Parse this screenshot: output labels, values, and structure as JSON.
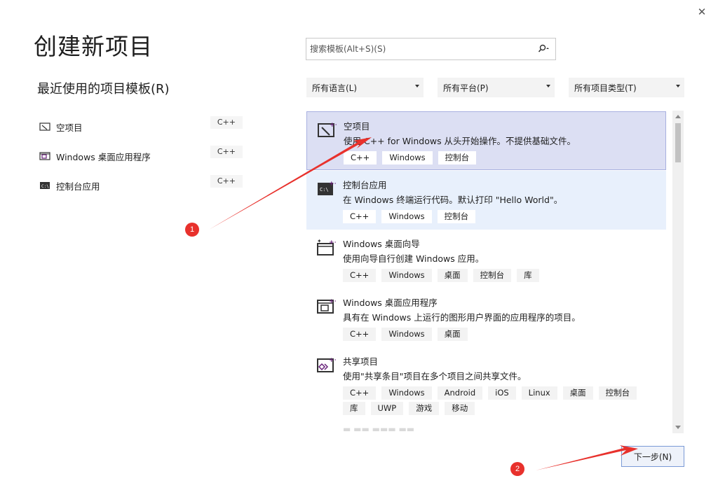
{
  "window": {
    "close_glyph": "✕"
  },
  "page": {
    "title": "创建新项目",
    "recent_title": "最近使用的项目模板(R)"
  },
  "recent": [
    {
      "label": "空项目",
      "tag": "C++",
      "icon": "empty-project-icon"
    },
    {
      "label": "Windows 桌面应用程序",
      "tag": "C++",
      "icon": "desktop-app-icon"
    },
    {
      "label": "控制台应用",
      "tag": "C++",
      "icon": "console-app-icon"
    }
  ],
  "search": {
    "placeholder": "搜索模板(Alt+S)(S)",
    "value": ""
  },
  "filters": {
    "language": "所有语言(L)",
    "platform": "所有平台(P)",
    "type": "所有项目类型(T)"
  },
  "templates": [
    {
      "title": "空项目",
      "desc": "使用 C++ for Windows 从头开始操作。不提供基础文件。",
      "tags": [
        "C++",
        "Windows",
        "控制台"
      ],
      "state": "selected",
      "icon": "empty-project-icon"
    },
    {
      "title": "控制台应用",
      "desc": "在 Windows 终端运行代码。默认打印 \"Hello World\"。",
      "tags": [
        "C++",
        "Windows",
        "控制台"
      ],
      "state": "hover",
      "icon": "console-app-icon"
    },
    {
      "title": "Windows 桌面向导",
      "desc": "使用向导自行创建 Windows 应用。",
      "tags": [
        "C++",
        "Windows",
        "桌面",
        "控制台",
        "库"
      ],
      "state": "normal",
      "icon": "desktop-wizard-icon"
    },
    {
      "title": "Windows 桌面应用程序",
      "desc": "具有在 Windows 上运行的图形用户界面的应用程序的项目。",
      "tags": [
        "C++",
        "Windows",
        "桌面"
      ],
      "state": "normal",
      "icon": "desktop-app-icon"
    },
    {
      "title": "共享项目",
      "desc": "使用\"共享条目\"项目在多个项目之间共享文件。",
      "tags": [
        "C++",
        "Windows",
        "Android",
        "iOS",
        "Linux",
        "桌面",
        "控制台",
        "库",
        "UWP",
        "游戏",
        "移动"
      ],
      "state": "normal",
      "icon": "shared-project-icon"
    }
  ],
  "footer": {
    "next_label": "下一步(N)"
  },
  "annotations": [
    {
      "number": "1"
    },
    {
      "number": "2"
    }
  ],
  "colors": {
    "accent": "#a8b0e0",
    "selected_bg": "#dcdff3",
    "hover_bg": "#e8f0fc",
    "annotation": "#e8312c"
  }
}
